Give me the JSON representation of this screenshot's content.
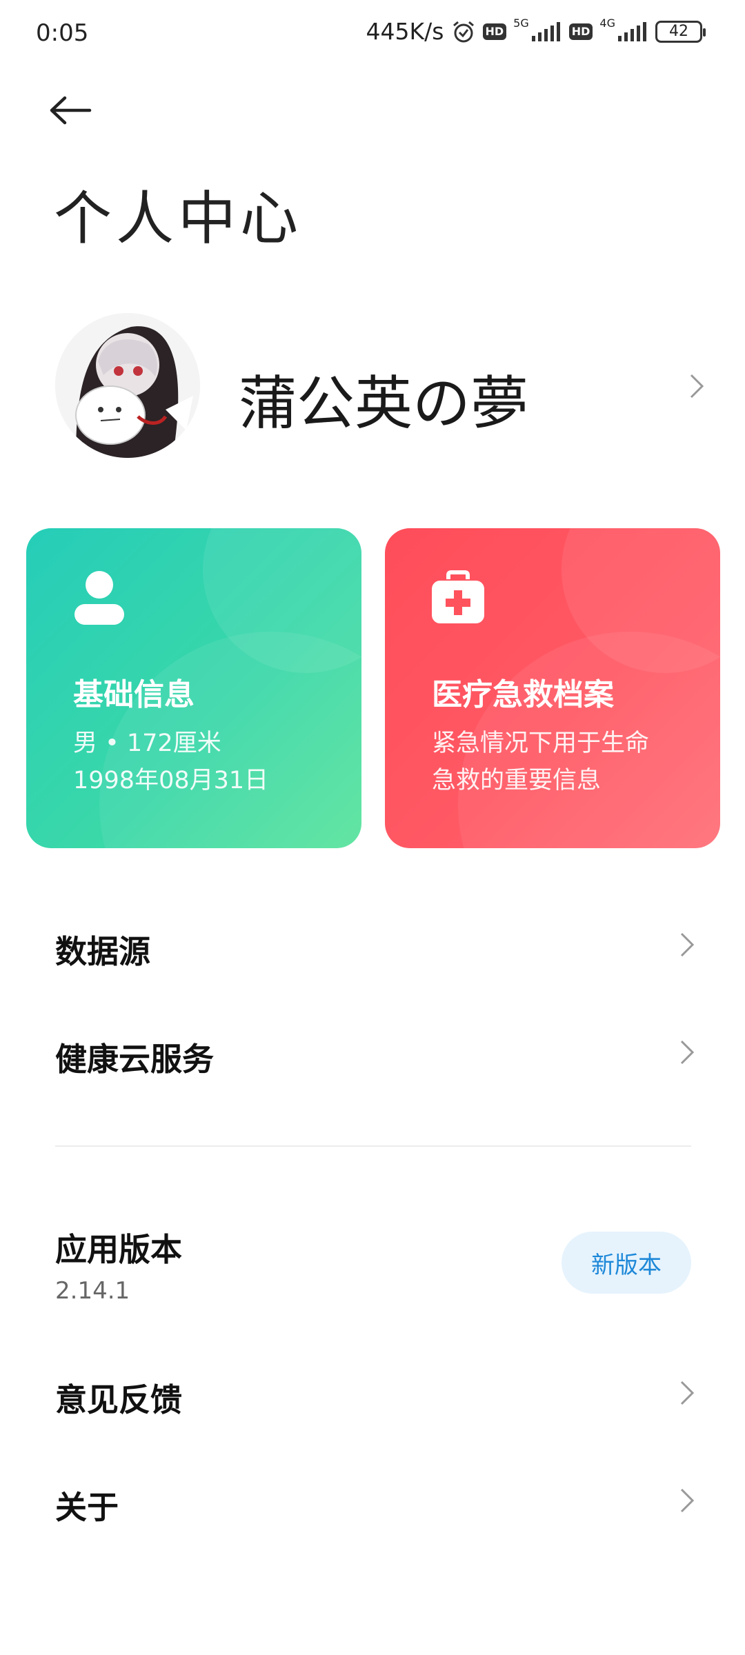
{
  "status_bar": {
    "time": "0:05",
    "net_speed": "445K/s",
    "hd1": "HD",
    "net1": "5G",
    "hd2": "HD",
    "net2": "4G",
    "battery": "42",
    "icons": [
      "alarm-icon",
      "signal-5g-icon",
      "signal-4g-icon",
      "battery-icon"
    ]
  },
  "header": {
    "back_icon": "arrow-left-icon",
    "title": "个人中心"
  },
  "profile": {
    "name": "蒲公英の夢",
    "avatar_icon": "anime-avatar",
    "chevron_icon": "chevron-right-icon"
  },
  "cards": {
    "basic": {
      "icon": "person-icon",
      "title": "基础信息",
      "line1": "男 • 172厘米",
      "line2": "1998年08月31日",
      "color": "#2ccfb6"
    },
    "medical": {
      "icon": "first-aid-kit-icon",
      "title": "医疗急救档案",
      "line1": "紧急情况下用于生命",
      "line2": "急救的重要信息",
      "color": "#ff525d"
    }
  },
  "menu": {
    "data_source": "数据源",
    "cloud_service": "健康云服务",
    "app_version_label": "应用版本",
    "app_version_value": "2.14.1",
    "new_version_badge": "新版本",
    "feedback": "意见反馈",
    "about": "关于"
  },
  "colors": {
    "badge_bg": "#e6f3fd",
    "badge_text": "#1e88d8"
  }
}
